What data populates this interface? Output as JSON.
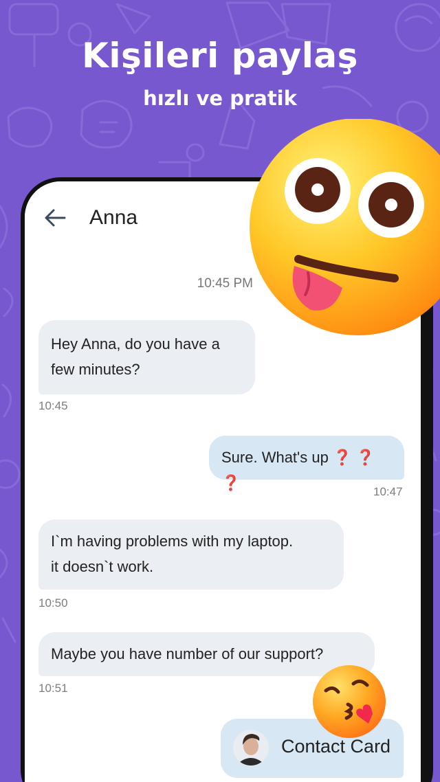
{
  "promo": {
    "headline": "Kişileri paylaş",
    "subheadline": "hızlı ve pratik"
  },
  "chat_header": {
    "contact_name": "Anna"
  },
  "chat": {
    "day_time": "10:45 PM",
    "messages": [
      {
        "direction": "incoming",
        "line1": "Hey Anna, do you have a",
        "line2": "few minutes?",
        "time": "10:45"
      },
      {
        "direction": "outgoing",
        "text": "Sure. What's up",
        "emoji": "❓ ❓ ❓",
        "time": "10:47"
      },
      {
        "direction": "incoming",
        "line1": "I`m having problems with my laptop.",
        "line2": "it doesn`t work.",
        "time": "10:50"
      },
      {
        "direction": "incoming",
        "text": "Maybe you have number of our support?",
        "time": "10:51"
      }
    ],
    "contact_card": {
      "label": "Contact Card"
    }
  },
  "colors": {
    "background": "#7758cf",
    "incoming_bubble": "#ebeef2",
    "outgoing_bubble": "#d8e7f4",
    "question_marks": "#d61f2c"
  },
  "decorations": {
    "big_emoji": "tongue-out-emoji",
    "small_emoji": "kissing-heart-emoji"
  }
}
